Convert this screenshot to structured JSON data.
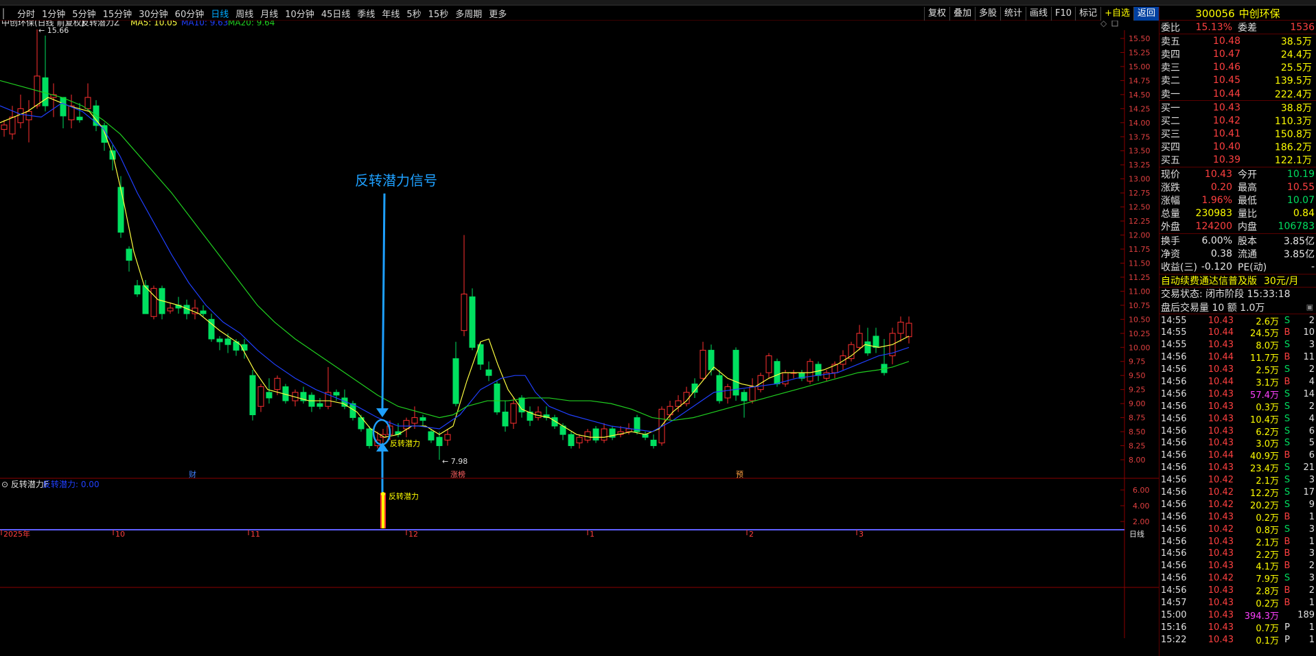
{
  "periods": [
    "分时",
    "1分钟",
    "5分钟",
    "15分钟",
    "30分钟",
    "60分钟",
    "日线",
    "周线",
    "月线",
    "10分钟",
    "45日线",
    "季线",
    "年线",
    "5秒",
    "15秒",
    "多周期",
    "更多"
  ],
  "active_period": "日线",
  "toolbar_right": [
    "复权",
    "叠加",
    "多股",
    "统计",
    "画线",
    "F10",
    "标记",
    "+自选",
    "返回"
  ],
  "chart_header": {
    "name": "中创环保(日线 前复权)",
    "indicator": "反转潜力Z",
    "ma5": "MA5: 10.05",
    "ma10": "MA10: 9.63",
    "ma20": "MA20: 9.64"
  },
  "annotations": {
    "high_label": "15.66",
    "low_label": "7.98",
    "signal_title": "反转潜力信号",
    "signal_tag": "反转潜力",
    "event_cai": "财",
    "event_zhangting": "涨榜",
    "event_yu": "预"
  },
  "sub_header": {
    "name": "反转潜力F",
    "value": "反转潜力: 0.00"
  },
  "x_axis": [
    "2025年",
    "10",
    "11",
    "12",
    "1",
    "2",
    "3"
  ],
  "x_axis_right": "日线",
  "price_axis": [
    "15.50",
    "15.25",
    "15.00",
    "14.75",
    "14.50",
    "14.25",
    "14.00",
    "13.75",
    "13.50",
    "13.25",
    "13.00",
    "12.75",
    "12.50",
    "12.25",
    "12.00",
    "11.75",
    "11.50",
    "11.25",
    "11.00",
    "10.75",
    "10.50",
    "10.25",
    "10.00",
    "9.75",
    "9.50",
    "9.25",
    "9.00",
    "8.75",
    "8.50",
    "8.25",
    "8.00"
  ],
  "sub_axis": [
    "6.00",
    "4.00",
    "2.00"
  ],
  "colors": {
    "up": "#ff3030",
    "down": "#00e060",
    "ma5": "#ffff40",
    "ma10": "#2040ff",
    "ma20": "#20d020",
    "signal": "#1ea0ff"
  },
  "stock": {
    "code": "300056",
    "name": "中创环保"
  },
  "weibi": {
    "label": "委比",
    "value": "15.13%",
    "label2": "委差",
    "value2": "1536"
  },
  "asks": [
    {
      "label": "卖五",
      "price": "10.48",
      "vol": "38.5万"
    },
    {
      "label": "卖四",
      "price": "10.47",
      "vol": "24.4万"
    },
    {
      "label": "卖三",
      "price": "10.46",
      "vol": "25.5万"
    },
    {
      "label": "卖二",
      "price": "10.45",
      "vol": "139.5万"
    },
    {
      "label": "卖一",
      "price": "10.44",
      "vol": "222.4万"
    }
  ],
  "bids": [
    {
      "label": "买一",
      "price": "10.43",
      "vol": "38.8万"
    },
    {
      "label": "买二",
      "price": "10.42",
      "vol": "110.3万"
    },
    {
      "label": "买三",
      "price": "10.41",
      "vol": "150.8万"
    },
    {
      "label": "买四",
      "price": "10.40",
      "vol": "186.2万"
    },
    {
      "label": "买五",
      "price": "10.39",
      "vol": "122.1万"
    }
  ],
  "quote": [
    {
      "l1": "现价",
      "v1": "10.43",
      "c1": "red",
      "l2": "今开",
      "v2": "10.19",
      "c2": "green"
    },
    {
      "l1": "涨跌",
      "v1": "0.20",
      "c1": "red",
      "l2": "最高",
      "v2": "10.55",
      "c2": "red"
    },
    {
      "l1": "涨幅",
      "v1": "1.96%",
      "c1": "red",
      "l2": "最低",
      "v2": "10.07",
      "c2": "green"
    },
    {
      "l1": "总量",
      "v1": "230983",
      "c1": "yellow",
      "l2": "量比",
      "v2": "0.84",
      "c2": "yellow"
    },
    {
      "l1": "外盘",
      "v1": "124200",
      "c1": "red",
      "l2": "内盘",
      "v2": "106783",
      "c2": "green"
    }
  ],
  "quote2": [
    {
      "l1": "换手",
      "v1": "6.00%",
      "l2": "股本",
      "v2": "3.85亿"
    },
    {
      "l1": "净资",
      "v1": "0.38",
      "l2": "流通",
      "v2": "3.85亿"
    },
    {
      "l1": "收益(三)",
      "v1": "-0.120",
      "l2": "PE(动)",
      "v2": "-"
    }
  ],
  "notice": {
    "text": "自动续费通达信普及版",
    "price": "30元/月"
  },
  "trade_status": "交易状态: 闭市阶段 15:33:18",
  "after_hours": "盘后交易量 10 额 1.0万",
  "ticks": [
    {
      "t": "14:55",
      "p": "10.43",
      "v": "2.6万",
      "bs": "S",
      "n": "2"
    },
    {
      "t": "14:55",
      "p": "10.44",
      "v": "24.5万",
      "bs": "B",
      "n": "10"
    },
    {
      "t": "14:55",
      "p": "10.43",
      "v": "8.0万",
      "bs": "S",
      "n": "3"
    },
    {
      "t": "14:56",
      "p": "10.44",
      "v": "11.7万",
      "bs": "B",
      "n": "11"
    },
    {
      "t": "14:56",
      "p": "10.43",
      "v": "2.5万",
      "bs": "S",
      "n": "2"
    },
    {
      "t": "14:56",
      "p": "10.44",
      "v": "3.1万",
      "bs": "B",
      "n": "4"
    },
    {
      "t": "14:56",
      "p": "10.43",
      "v": "57.4万",
      "bs": "S",
      "n": "14"
    },
    {
      "t": "14:56",
      "p": "10.43",
      "v": "0.3万",
      "bs": "S",
      "n": "2"
    },
    {
      "t": "14:56",
      "p": "10.43",
      "v": "10.4万",
      "bs": "S",
      "n": "4"
    },
    {
      "t": "14:56",
      "p": "10.43",
      "v": "6.2万",
      "bs": "S",
      "n": "6"
    },
    {
      "t": "14:56",
      "p": "10.43",
      "v": "3.0万",
      "bs": "S",
      "n": "5"
    },
    {
      "t": "14:56",
      "p": "10.44",
      "v": "40.9万",
      "bs": "B",
      "n": "6"
    },
    {
      "t": "14:56",
      "p": "10.43",
      "v": "23.4万",
      "bs": "S",
      "n": "21"
    },
    {
      "t": "14:56",
      "p": "10.42",
      "v": "2.1万",
      "bs": "S",
      "n": "3"
    },
    {
      "t": "14:56",
      "p": "10.42",
      "v": "12.2万",
      "bs": "S",
      "n": "17"
    },
    {
      "t": "14:56",
      "p": "10.42",
      "v": "20.2万",
      "bs": "S",
      "n": "9"
    },
    {
      "t": "14:56",
      "p": "10.43",
      "v": "0.2万",
      "bs": "B",
      "n": "1"
    },
    {
      "t": "14:56",
      "p": "10.42",
      "v": "0.8万",
      "bs": "S",
      "n": "3"
    },
    {
      "t": "14:56",
      "p": "10.43",
      "v": "2.1万",
      "bs": "B",
      "n": "1"
    },
    {
      "t": "14:56",
      "p": "10.43",
      "v": "2.2万",
      "bs": "B",
      "n": "3"
    },
    {
      "t": "14:56",
      "p": "10.43",
      "v": "4.1万",
      "bs": "B",
      "n": "2"
    },
    {
      "t": "14:56",
      "p": "10.42",
      "v": "7.9万",
      "bs": "S",
      "n": "3"
    },
    {
      "t": "14:56",
      "p": "10.43",
      "v": "2.8万",
      "bs": "B",
      "n": "2"
    },
    {
      "t": "14:57",
      "p": "10.43",
      "v": "0.2万",
      "bs": "B",
      "n": "1"
    },
    {
      "t": "15:00",
      "p": "10.43",
      "v": "394.3万",
      "bs": "",
      "n": "189"
    },
    {
      "t": "15:16",
      "p": "10.43",
      "v": "0.7万",
      "bs": "P",
      "n": "1"
    },
    {
      "t": "15:22",
      "p": "10.43",
      "v": "0.1万",
      "bs": "P",
      "n": "1"
    }
  ]
}
